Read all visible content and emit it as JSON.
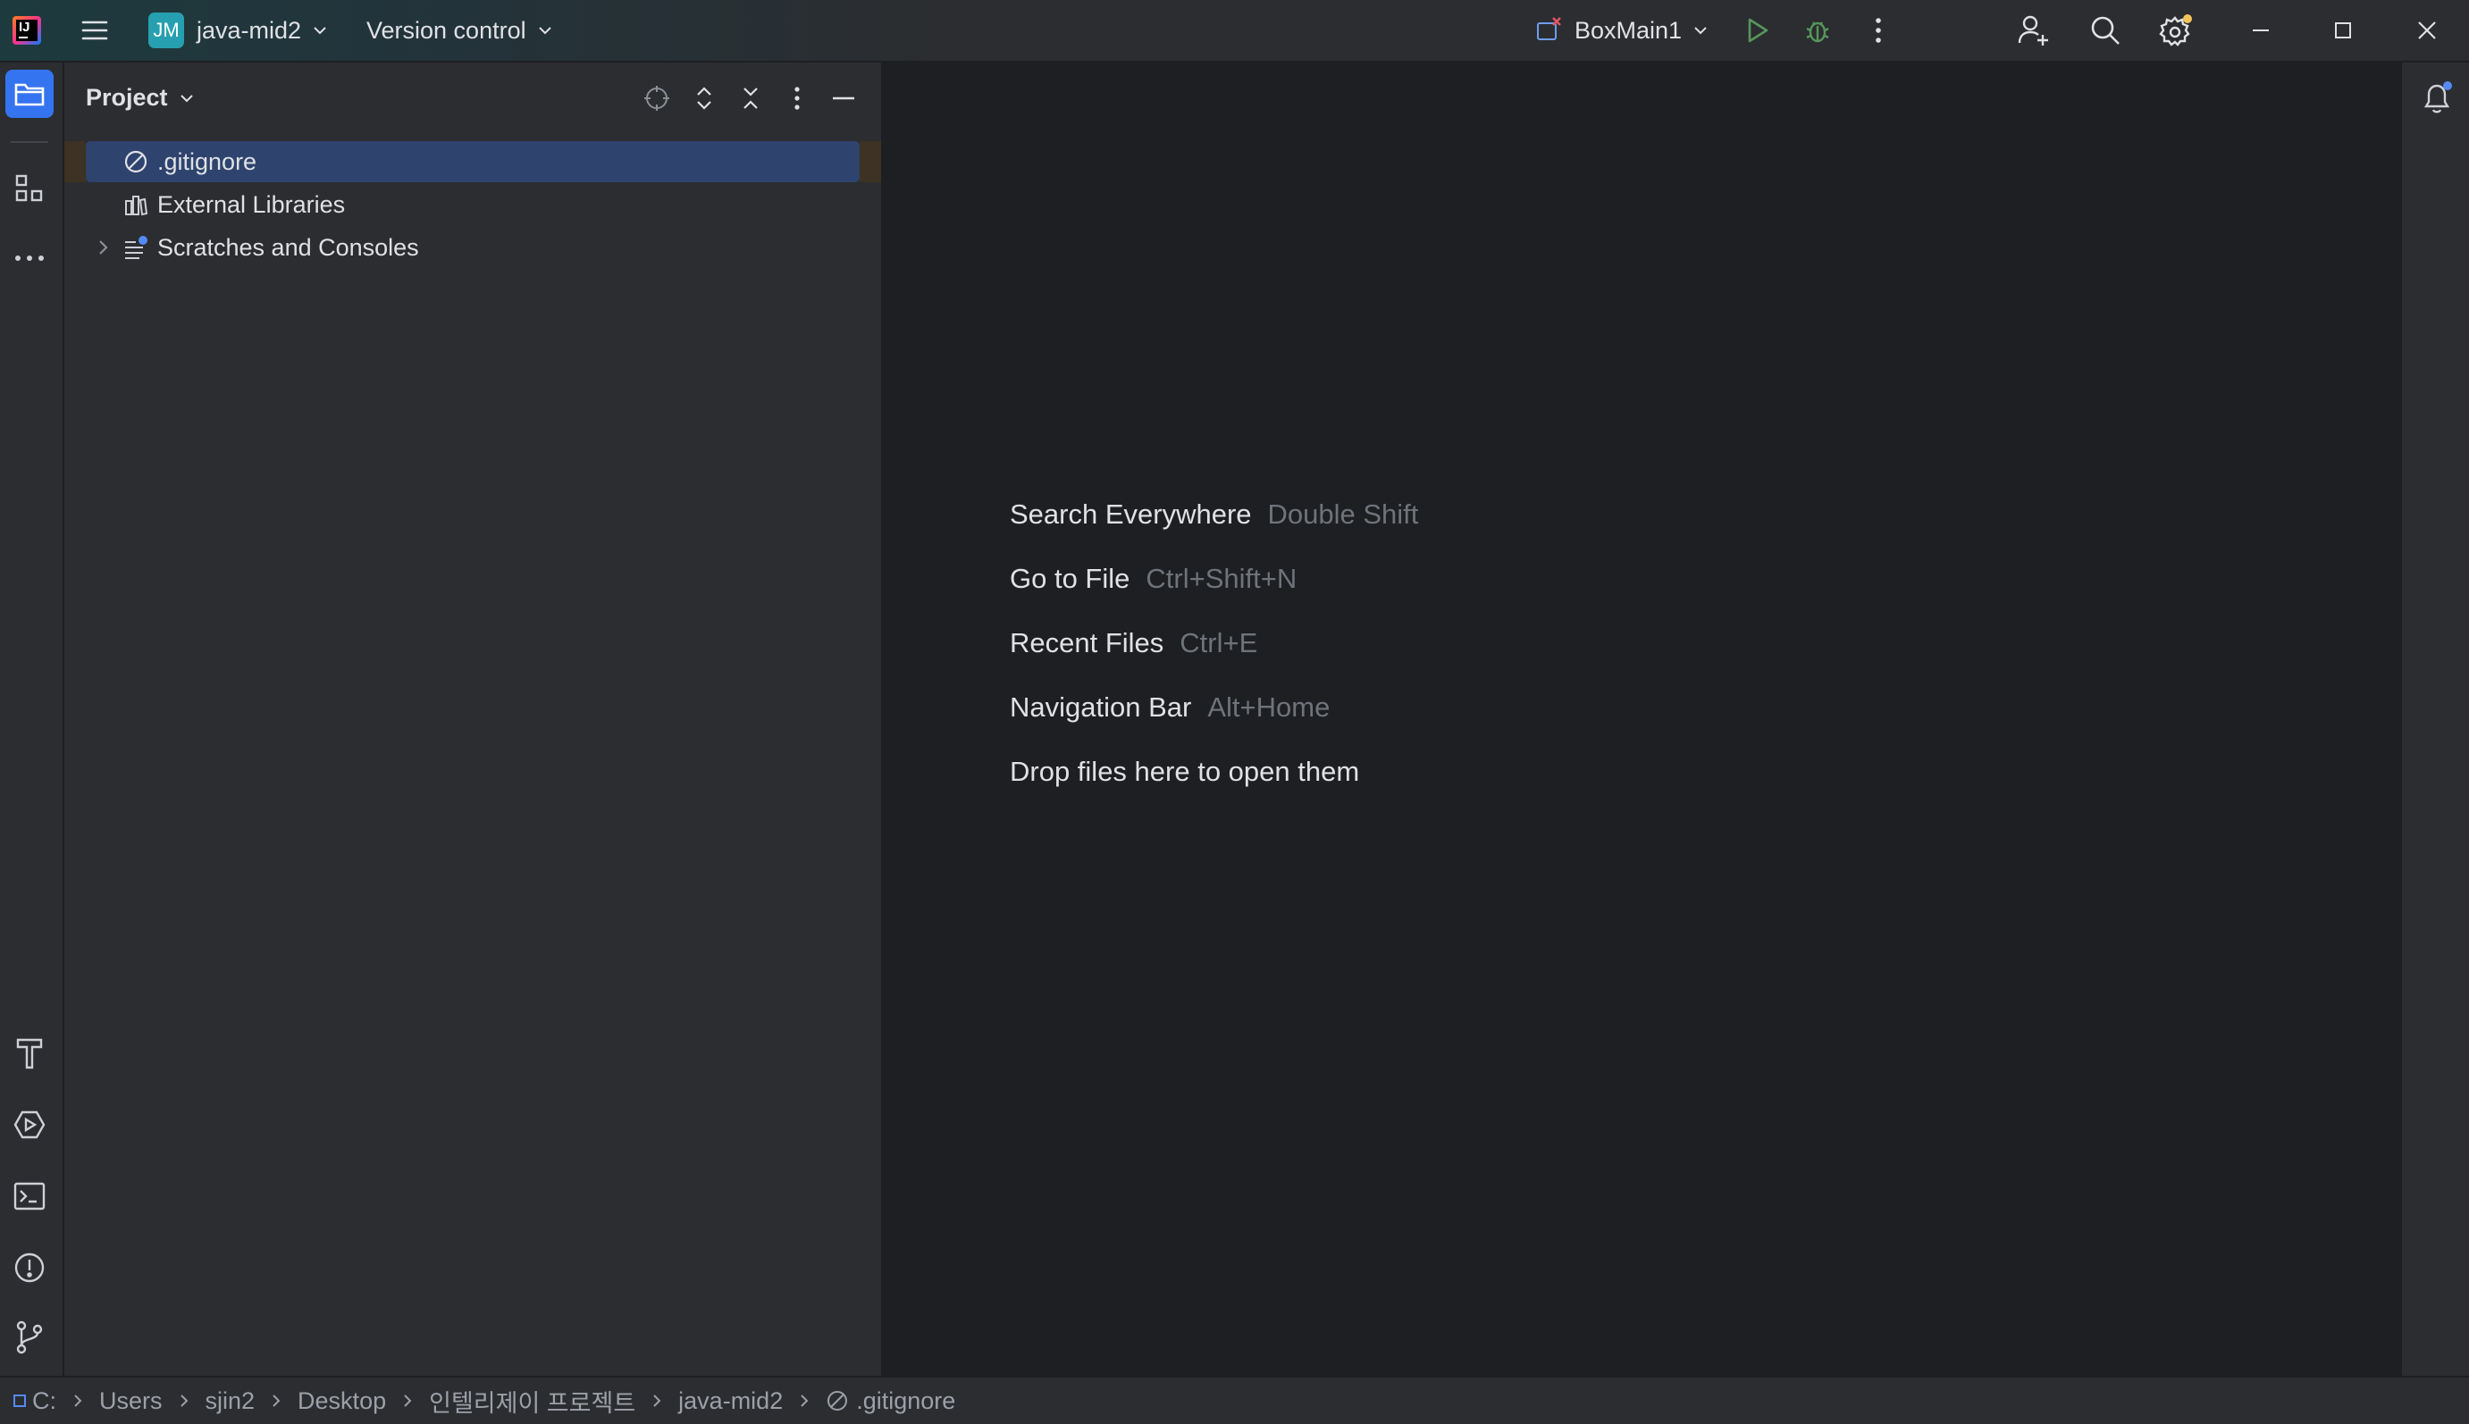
{
  "titlebar": {
    "project_badge": "JM",
    "project_name": "java-mid2",
    "vcs_label": "Version control",
    "run_config": "BoxMain1",
    "icons": [
      "main-menu-icon",
      "run-icon",
      "debug-icon",
      "more-vertical-icon",
      "add-user-icon",
      "search-icon",
      "settings-icon",
      "minimize-icon",
      "maximize-icon",
      "close-icon"
    ],
    "colors": {
      "run": "#57965c",
      "debug": "#57965c",
      "settings_badge": "#f2c55c"
    }
  },
  "left_strip": {
    "top": [
      "project-folder-icon",
      "structure-icon",
      "more-tools-icon"
    ],
    "bottom": [
      "build-hammer-icon",
      "services-run-icon",
      "terminal-icon",
      "problems-icon",
      "git-branch-icon"
    ]
  },
  "project_panel": {
    "title": "Project",
    "tree": [
      {
        "label": ".gitignore",
        "icon": "ignore-file-icon",
        "selected": true
      },
      {
        "label": "External Libraries",
        "icon": "library-icon",
        "selected": false
      },
      {
        "label": "Scratches and Consoles",
        "icon": "scratches-icon",
        "selected": false,
        "expandable": true
      }
    ]
  },
  "editor_hints": [
    {
      "action": "Search Everywhere",
      "shortcut": "Double Shift"
    },
    {
      "action": "Go to File",
      "shortcut": "Ctrl+Shift+N"
    },
    {
      "action": "Recent Files",
      "shortcut": "Ctrl+E"
    },
    {
      "action": "Navigation Bar",
      "shortcut": "Alt+Home"
    },
    {
      "action": "Drop files here to open them",
      "shortcut": ""
    }
  ],
  "statusbar": {
    "breadcrumbs": [
      "C:",
      "Users",
      "sjin2",
      "Desktop",
      "인텔리제이 프로젝트",
      "java-mid2",
      ".gitignore"
    ]
  }
}
